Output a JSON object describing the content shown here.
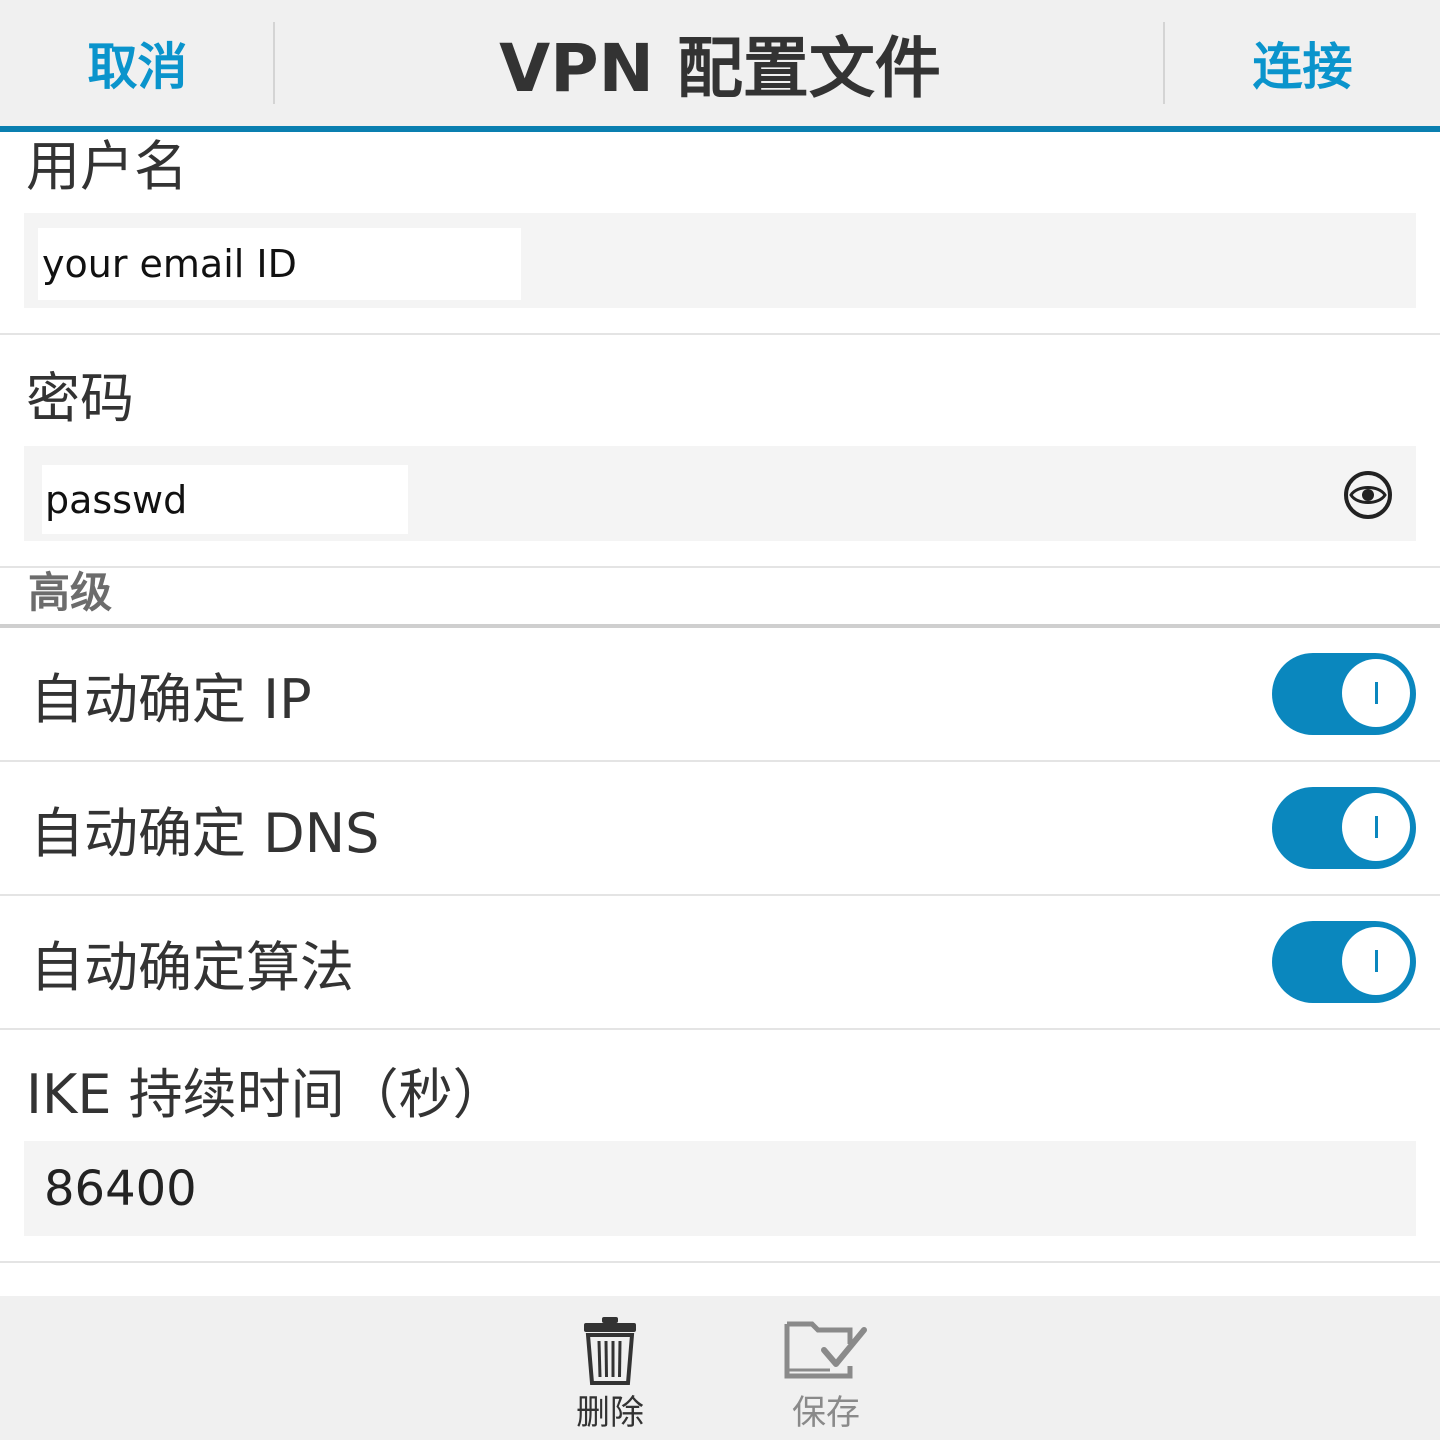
{
  "titlebar": {
    "cancel_label": "取消",
    "title": "VPN 配置文件",
    "connect_label": "连接"
  },
  "colors": {
    "accent": "#0a94cc",
    "toggle_on": "#0a87be",
    "bar_background": "#f0f0f0"
  },
  "form": {
    "username": {
      "label": "用户名",
      "value": "your email ID"
    },
    "password": {
      "label": "密码",
      "value": "passwd",
      "reveal_icon": "eye-icon"
    },
    "advanced": {
      "header": "高级",
      "toggles": [
        {
          "label": "自动确定 IP",
          "on": true
        },
        {
          "label": "自动确定 DNS",
          "on": true
        },
        {
          "label": "自动确定算法",
          "on": true
        }
      ]
    },
    "ike_lifetime": {
      "label": "IKE 持续时间（秒）",
      "value": "86400"
    }
  },
  "actions": {
    "delete": {
      "label": "删除",
      "icon": "trash-icon"
    },
    "save": {
      "label": "保存",
      "icon": "folder-check-icon",
      "enabled": false
    }
  }
}
